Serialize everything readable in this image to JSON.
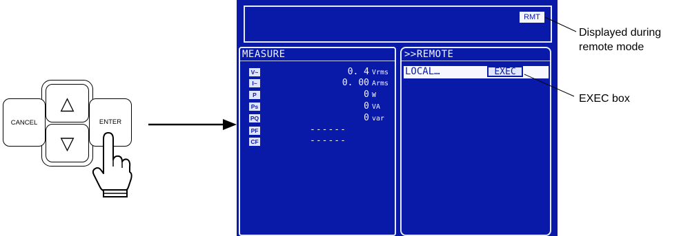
{
  "keypad": {
    "cancel_label": "CANCEL",
    "enter_label": "ENTER",
    "up_symbol": "△",
    "down_symbol": "▽"
  },
  "display": {
    "rmt_indicator": "RMT",
    "measure": {
      "title": "MEASURE",
      "rows": [
        {
          "badge": "V~",
          "value": "0. 4",
          "unit": "Vrms"
        },
        {
          "badge": "I~",
          "value": "0. 00",
          "unit": "Arms"
        },
        {
          "badge": "P",
          "value": "0",
          "unit": "W"
        },
        {
          "badge": "Ps",
          "value": "0",
          "unit": "VA"
        },
        {
          "badge": "PQ",
          "value": "0",
          "unit": "var"
        },
        {
          "badge": "PF",
          "value": "------",
          "unit": ""
        },
        {
          "badge": "CF",
          "value": "------",
          "unit": ""
        }
      ]
    },
    "remote": {
      "title": ">>REMOTE",
      "item_label": "LOCAL…",
      "exec_label": "EXEC"
    }
  },
  "callouts": {
    "rmt_note_line1": "Displayed during",
    "rmt_note_line2": "remote mode",
    "exec_note": "EXEC box"
  }
}
